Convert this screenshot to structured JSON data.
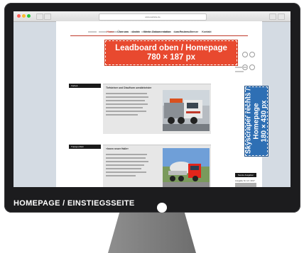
{
  "browser": {
    "url": "www.website.de",
    "bookmarks": [
      "",
      "",
      "",
      "",
      "",
      "",
      "",
      "",
      "",
      ""
    ]
  },
  "site": {
    "nav": [
      "Home",
      "Über uns",
      "Archiv",
      "Werbe-Dokumentation",
      "Los Paulers-Grenze",
      "Kontakt"
    ],
    "nav_active_index": 0
  },
  "ads": {
    "leaderboard_line1": "Leadboard oben / Homepage",
    "leaderboard_line2": "780 × 187 px",
    "leaderboard_color": "#e8492f",
    "skyscraper_line1": "Skyscraper rechts /",
    "skyscraper_line2": "Homepage",
    "skyscraper_line3": "180 × 430 px",
    "skyscraper_color": "#2e6fb4"
  },
  "articles": [
    {
      "section_label": "Vorbeit",
      "headline": "Tiefsteiner und Diaufhorn umstärkeister"
    },
    {
      "section_label": "Transportbild",
      "headline": "«Innen neuer Halle»"
    }
  ],
  "sidebar": {
    "box_label": "Neuste Ausgaben",
    "date_text": "Ausgabe Nr. 14 / 2017"
  },
  "caption": {
    "text": "HOMEPAGE / EINSTIEGSSEITE"
  },
  "colors": {
    "bezel": "#1c1c1e",
    "accent_red": "#c0392b"
  }
}
